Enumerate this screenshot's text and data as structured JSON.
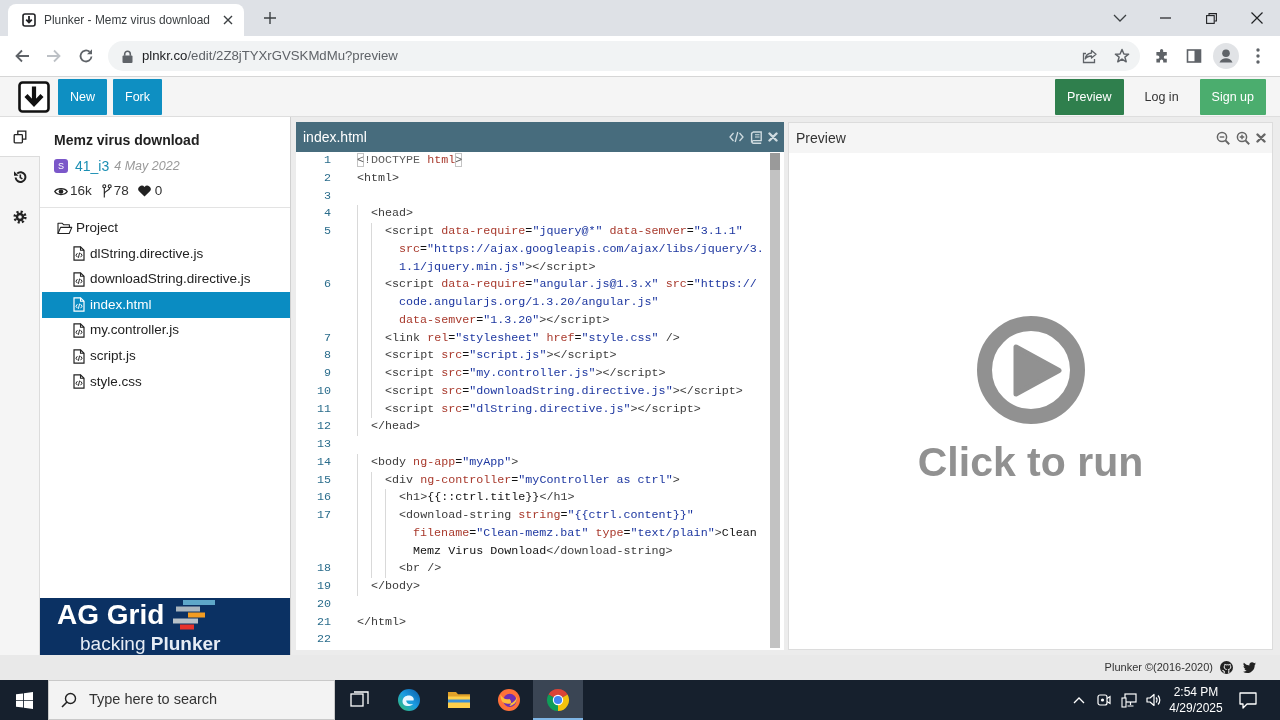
{
  "browser": {
    "tab": {
      "title": "Plunker - Memz virus download"
    },
    "url": {
      "host": "plnkr.co",
      "path": "/edit/2Z8jTYXrGVSKMdMu?preview"
    }
  },
  "navbar": {
    "left_buttons": [
      {
        "label": "New",
        "kind": "primary"
      },
      {
        "label": "Fork",
        "kind": "primary"
      }
    ],
    "right_buttons": [
      {
        "label": "Preview",
        "kind": "preview"
      },
      {
        "label": "Log in",
        "kind": "link"
      },
      {
        "label": "Sign up",
        "kind": "signup"
      }
    ]
  },
  "rail": [
    {
      "kind": "files",
      "selected": true
    },
    {
      "kind": "history",
      "selected": false
    },
    {
      "kind": "settings",
      "selected": false
    }
  ],
  "project": {
    "title": "Memz virus download",
    "author": {
      "initial": "S",
      "name": "41_i3"
    },
    "date": "4 May 2022",
    "stats": {
      "views": "16k",
      "forks": "78",
      "likes": "0"
    }
  },
  "tree": {
    "label": "Project",
    "expanded": true,
    "children": [
      {
        "label": "dlString.directive.js",
        "selected": false
      },
      {
        "label": "downloadString.directive.js",
        "selected": false
      },
      {
        "label": "index.html",
        "selected": true
      },
      {
        "label": "my.controller.js",
        "selected": false
      },
      {
        "label": "script.js",
        "selected": false
      },
      {
        "label": "style.css",
        "selected": false
      }
    ]
  },
  "ad": {
    "brand": "AG Grid",
    "tagline": "backing **Plunker**"
  },
  "editor": {
    "filename": "index.html",
    "lines": [
      {
        "number": "1",
        "tokens": [
          {
            "kind": "match",
            "text": "<"
          },
          {
            "kind": "meta",
            "text": "!DOCTYPE "
          },
          {
            "kind": "attr",
            "text": "html"
          },
          {
            "kind": "match",
            "text": ">"
          }
        ]
      },
      {
        "number": "2",
        "tokens": [
          {
            "kind": "tag",
            "text": "<html>"
          }
        ]
      },
      {
        "number": "3"
      },
      {
        "number": "4",
        "tokens": [
          {
            "kind": "tag",
            "text": "  <head>"
          }
        ]
      },
      {
        "number": "5",
        "tokens": [
          {
            "kind": "tag",
            "text": "    <script"
          },
          {
            "kind": "attr",
            "text": " data-require"
          },
          {
            "kind": "text",
            "text": "="
          },
          {
            "kind": "string",
            "text": "\"jquery@*\""
          },
          {
            "kind": "attr",
            "text": " data-semver"
          },
          {
            "kind": "text",
            "text": "="
          },
          {
            "kind": "string",
            "text": "\"3.1.1\""
          }
        ],
        "wrapped": [
          {
            "tokens": [
              {
                "kind": "attr",
                "text": "src"
              },
              {
                "kind": "text",
                "text": "="
              },
              {
                "kind": "string",
                "text": "\"https://ajax.googleapis.com/ajax/libs/jquery/3."
              }
            ]
          },
          {
            "tokens": [
              {
                "kind": "string",
                "text": "1.1/jquery.min.js\""
              },
              {
                "kind": "tag",
                "text": "></script>"
              }
            ]
          }
        ]
      },
      {
        "number": "6",
        "tokens": [
          {
            "kind": "tag",
            "text": "    <script"
          },
          {
            "kind": "attr",
            "text": " data-require"
          },
          {
            "kind": "text",
            "text": "="
          },
          {
            "kind": "string",
            "text": "\"angular.js@1.3.x\""
          },
          {
            "kind": "attr",
            "text": " src"
          },
          {
            "kind": "text",
            "text": "="
          },
          {
            "kind": "string",
            "text": "\"https://"
          }
        ],
        "wrapped": [
          {
            "tokens": [
              {
                "kind": "string",
                "text": "code.angularjs.org/1.3.20/angular.js\""
              }
            ]
          },
          {
            "tokens": [
              {
                "kind": "attr",
                "text": "data-semver"
              },
              {
                "kind": "text",
                "text": "="
              },
              {
                "kind": "string",
                "text": "\"1.3.20\""
              },
              {
                "kind": "tag",
                "text": "></script>"
              }
            ]
          }
        ]
      },
      {
        "number": "7",
        "tokens": [
          {
            "kind": "tag",
            "text": "    <link"
          },
          {
            "kind": "attr",
            "text": " rel"
          },
          {
            "kind": "text",
            "text": "="
          },
          {
            "kind": "string",
            "text": "\"stylesheet\""
          },
          {
            "kind": "attr",
            "text": " href"
          },
          {
            "kind": "text",
            "text": "="
          },
          {
            "kind": "string",
            "text": "\"style.css\""
          },
          {
            "kind": "tag",
            "text": " />"
          }
        ]
      },
      {
        "number": "8",
        "tokens": [
          {
            "kind": "tag",
            "text": "    <script"
          },
          {
            "kind": "attr",
            "text": " src"
          },
          {
            "kind": "text",
            "text": "="
          },
          {
            "kind": "string",
            "text": "\"script.js\""
          },
          {
            "kind": "tag",
            "text": "></script>"
          }
        ]
      },
      {
        "number": "9",
        "tokens": [
          {
            "kind": "tag",
            "text": "    <script"
          },
          {
            "kind": "attr",
            "text": " src"
          },
          {
            "kind": "text",
            "text": "="
          },
          {
            "kind": "string",
            "text": "\"my.controller.js\""
          },
          {
            "kind": "tag",
            "text": "></script>"
          }
        ]
      },
      {
        "number": "10",
        "tokens": [
          {
            "kind": "tag",
            "text": "    <script"
          },
          {
            "kind": "attr",
            "text": " src"
          },
          {
            "kind": "text",
            "text": "="
          },
          {
            "kind": "string",
            "text": "\"downloadString.directive.js\""
          },
          {
            "kind": "tag",
            "text": "></script>"
          }
        ]
      },
      {
        "number": "11",
        "tokens": [
          {
            "kind": "tag",
            "text": "    <script"
          },
          {
            "kind": "attr",
            "text": " src"
          },
          {
            "kind": "text",
            "text": "="
          },
          {
            "kind": "string",
            "text": "\"dlString.directive.js\""
          },
          {
            "kind": "tag",
            "text": "></script>"
          }
        ]
      },
      {
        "number": "12",
        "tokens": [
          {
            "kind": "tag",
            "text": "  </head>"
          }
        ]
      },
      {
        "number": "13"
      },
      {
        "number": "14",
        "tokens": [
          {
            "kind": "tag",
            "text": "  <body"
          },
          {
            "kind": "attr",
            "text": " ng-app"
          },
          {
            "kind": "text",
            "text": "="
          },
          {
            "kind": "string",
            "text": "\"myApp\""
          },
          {
            "kind": "tag",
            "text": ">"
          }
        ]
      },
      {
        "number": "15",
        "tokens": [
          {
            "kind": "tag",
            "text": "    <div"
          },
          {
            "kind": "attr",
            "text": " ng-controller"
          },
          {
            "kind": "text",
            "text": "="
          },
          {
            "kind": "string",
            "text": "\"myController as ctrl\""
          },
          {
            "kind": "tag",
            "text": ">"
          }
        ]
      },
      {
        "number": "16",
        "tokens": [
          {
            "kind": "tag",
            "text": "      <h1>"
          },
          {
            "kind": "text",
            "text": "{{::ctrl.title}}"
          },
          {
            "kind": "tag",
            "text": "</h1>"
          }
        ]
      },
      {
        "number": "17",
        "tokens": [
          {
            "kind": "tag",
            "text": "      <download-string"
          },
          {
            "kind": "attr",
            "text": " string"
          },
          {
            "kind": "text",
            "text": "="
          },
          {
            "kind": "string",
            "text": "\"{{ctrl.content}}\""
          }
        ],
        "wrapped": [
          {
            "tokens": [
              {
                "kind": "attr",
                "text": "filename"
              },
              {
                "kind": "text",
                "text": "="
              },
              {
                "kind": "string",
                "text": "\"Clean-memz.bat\""
              },
              {
                "kind": "attr",
                "text": " type"
              },
              {
                "kind": "text",
                "text": "="
              },
              {
                "kind": "string",
                "text": "\"text/plain\""
              },
              {
                "kind": "tag",
                "text": ">"
              },
              {
                "kind": "text",
                "text": "Clean"
              }
            ]
          },
          {
            "tokens": [
              {
                "kind": "text",
                "text": "Memz Virus Download"
              },
              {
                "kind": "tag",
                "text": "</download-string>"
              }
            ]
          }
        ]
      },
      {
        "number": "18",
        "tokens": [
          {
            "kind": "tag",
            "text": "      <br />"
          }
        ]
      },
      {
        "number": "19",
        "tokens": [
          {
            "kind": "tag",
            "text": "  </body>"
          }
        ]
      },
      {
        "number": "20"
      },
      {
        "number": "21",
        "tokens": [
          {
            "kind": "tag",
            "text": "</html>"
          }
        ]
      },
      {
        "number": "22"
      }
    ]
  },
  "preview": {
    "title": "Preview",
    "message": "Click to run"
  },
  "footer": {
    "copyright": "Plunker ©(2016-2020)"
  },
  "taskbar": {
    "search": {
      "placeholder": "Type here to search"
    },
    "apps": [
      {
        "kind": "taskview",
        "selected": false
      },
      {
        "kind": "swirl",
        "selected": false
      },
      {
        "kind": "folder",
        "selected": false
      },
      {
        "kind": "fox",
        "selected": false
      },
      {
        "kind": "circle",
        "selected": true
      }
    ],
    "clock": {
      "time": "2:54 PM",
      "date": "4/29/2025"
    }
  }
}
